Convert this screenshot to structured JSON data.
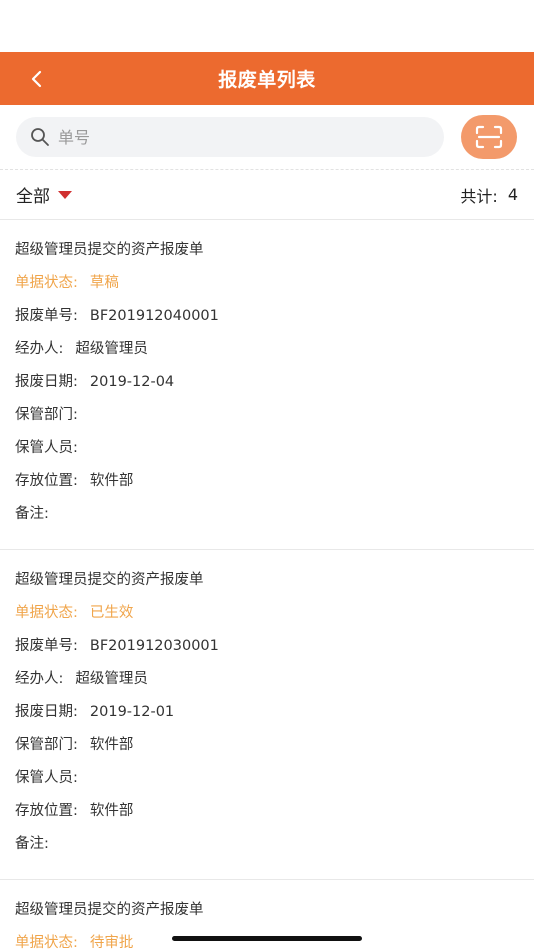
{
  "header": {
    "title": "报废单列表"
  },
  "search": {
    "placeholder": "单号"
  },
  "filter": {
    "selected": "全部",
    "total_label": "共计:",
    "total_count": "4"
  },
  "labels": {
    "status": "单据状态:",
    "number": "报废单号:",
    "handler": "经办人:",
    "date": "报废日期:",
    "dept": "保管部门:",
    "keeper": "保管人员:",
    "location": "存放位置:",
    "note": "备注:"
  },
  "records": [
    {
      "title": "超级管理员提交的资产报废单",
      "status": "草稿",
      "number": "BF201912040001",
      "handler": "超级管理员",
      "date": "2019-12-04",
      "dept": "",
      "keeper": "",
      "location": "软件部",
      "note": ""
    },
    {
      "title": "超级管理员提交的资产报废单",
      "status": "已生效",
      "number": "BF201912030001",
      "handler": "超级管理员",
      "date": "2019-12-01",
      "dept": "软件部",
      "keeper": "",
      "location": "软件部",
      "note": ""
    },
    {
      "title": "超级管理员提交的资产报废单",
      "status": "待审批"
    }
  ],
  "colors": {
    "accent": "#ec6a2f",
    "status": "#f0a54b",
    "caret": "#d03030"
  }
}
